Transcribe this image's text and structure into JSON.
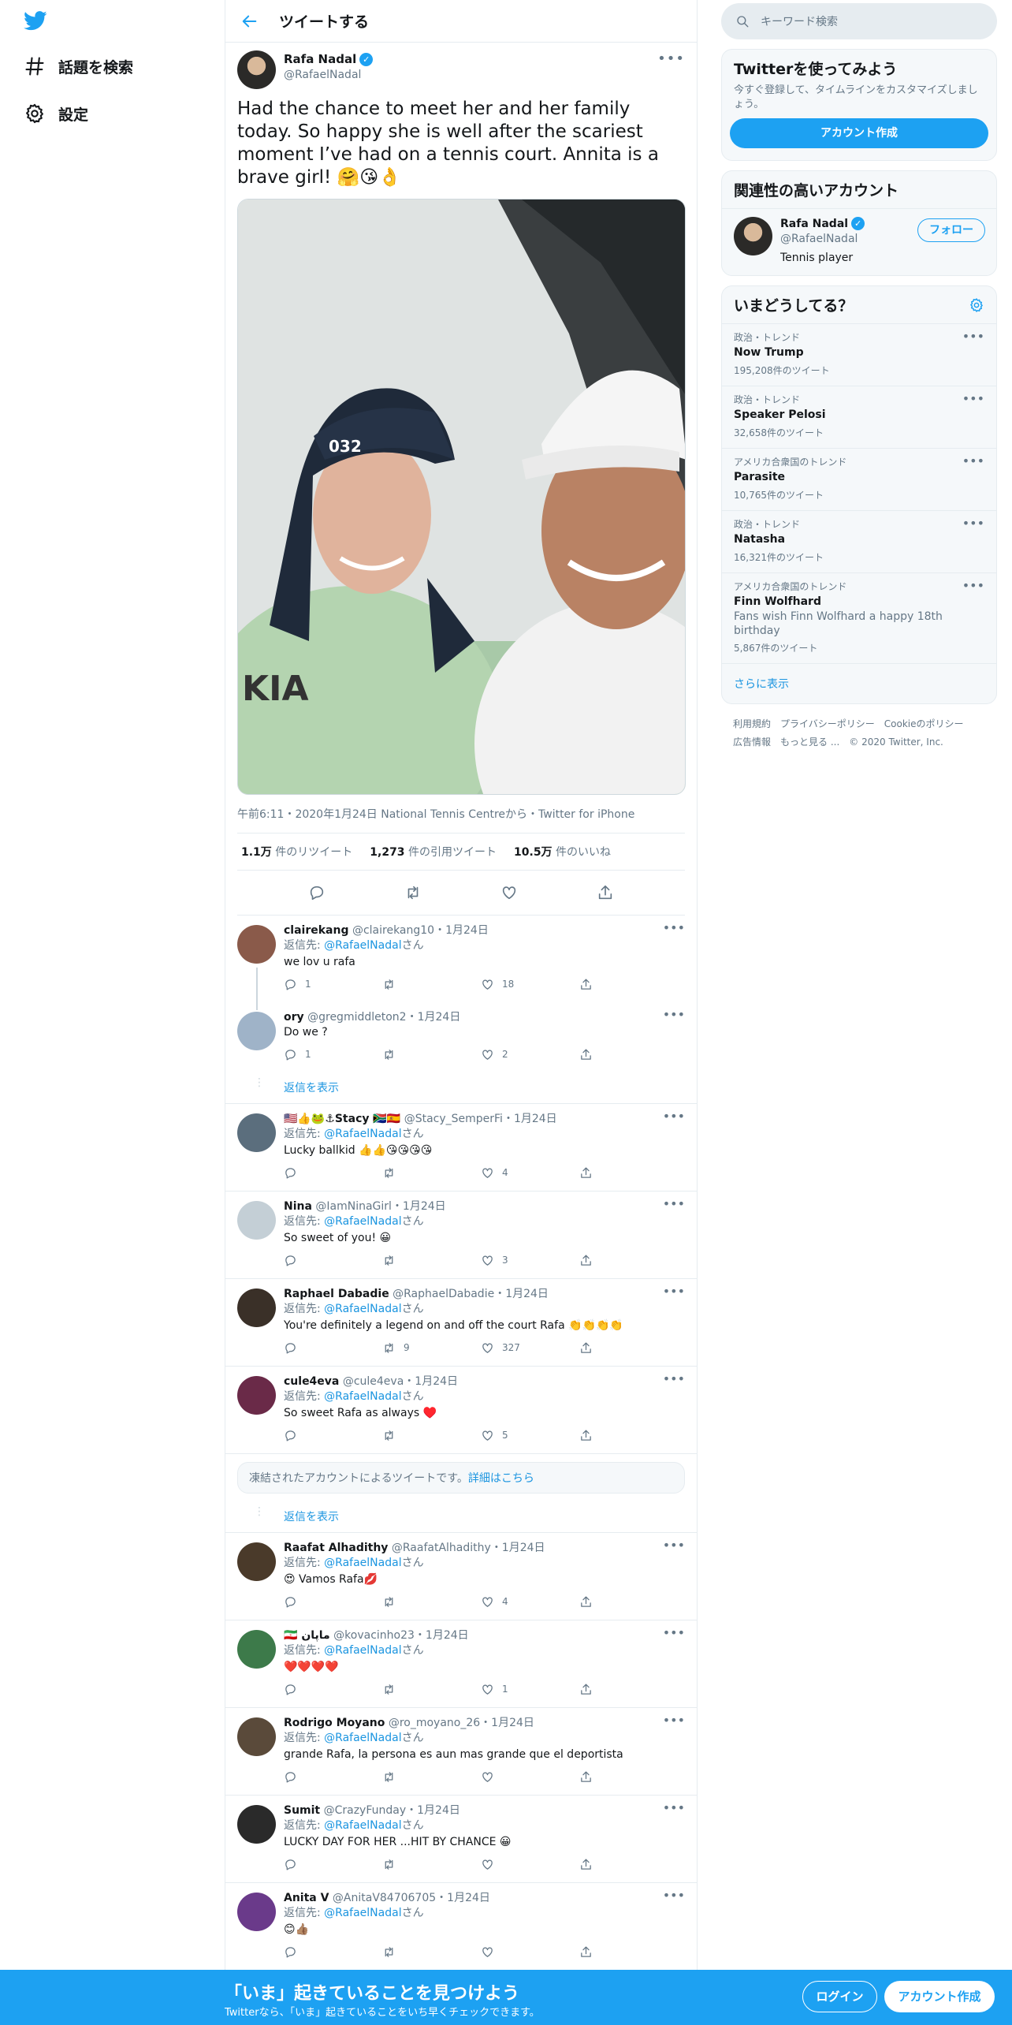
{
  "nav": {
    "items": [
      {
        "label": "話題を検索",
        "icon": "hashtag-icon"
      },
      {
        "label": "設定",
        "icon": "gear-icon"
      }
    ]
  },
  "header": {
    "title": "ツイートする"
  },
  "tweet": {
    "name": "Rafa Nadal",
    "handle": "@RafaelNadal",
    "text": "Had the chance to meet her and her family today. So happy she is well after the scariest moment I’ve had on a tennis court. Annita is a brave girl! 🤗😘👌",
    "meta": "午前6:11・2020年1月24日 National Tennis Centreから・Twitter for iPhone",
    "stats": {
      "retweets_num": "1.1万",
      "retweets_label": "件のリツイート",
      "quotes_num": "1,273",
      "quotes_label": "件の引用ツイート",
      "likes_num": "10.5万",
      "likes_label": "件のいいね"
    }
  },
  "replies": [
    {
      "name": "clairekang",
      "handle": "@clairekang10",
      "date": "・1月24日",
      "reply_prefix": "返信先: ",
      "reply_to": "@RafaelNadal",
      "reply_suffix": "さん",
      "text": "we lov u rafa",
      "replies": "1",
      "retweets": "",
      "likes": "18",
      "avatar": "#8a5a4a"
    },
    {
      "name": "ory",
      "handle": "@gregmiddleton2",
      "date": "・1月24日",
      "reply_prefix": "",
      "reply_to": "",
      "reply_suffix": "",
      "text": "Do we ?",
      "replies": "1",
      "retweets": "",
      "likes": "2",
      "avatar": "#9fb3c8"
    },
    {
      "name": "🇺🇸👍🐸⚓Stacy 🇿🇦🇪🇸",
      "handle": "@Stacy_SemperFi",
      "date": "・1月24日",
      "reply_prefix": "返信先: ",
      "reply_to": "@RafaelNadal",
      "reply_suffix": "さん",
      "text": "Lucky ballkid 👍👍😘😘😘😘",
      "replies": "",
      "retweets": "",
      "likes": "4",
      "avatar": "#5b6e7d"
    },
    {
      "name": "Nina",
      "handle": "@IamNinaGirl",
      "date": "・1月24日",
      "reply_prefix": "返信先: ",
      "reply_to": "@RafaelNadal",
      "reply_suffix": "さん",
      "text": "So sweet of you! 😀",
      "replies": "",
      "retweets": "",
      "likes": "3",
      "avatar": "#c4cfd6"
    },
    {
      "name": "Raphael Dabadie",
      "handle": "@RaphaelDabadie",
      "date": "・1月24日",
      "reply_prefix": "返信先: ",
      "reply_to": "@RafaelNadal",
      "reply_suffix": "さん",
      "text": "You're definitely a legend on and off the court Rafa 👏👏👏👏",
      "replies": "",
      "retweets": "9",
      "likes": "327",
      "avatar": "#3a3028"
    },
    {
      "name": "cule4eva",
      "handle": "@cule4eva",
      "date": "・1月24日",
      "reply_prefix": "返信先: ",
      "reply_to": "@RafaelNadal",
      "reply_suffix": "さん",
      "text": "So sweet Rafa as always ♥️",
      "replies": "",
      "retweets": "",
      "likes": "5",
      "avatar": "#6a2a48"
    }
  ],
  "show_replies_label": "返信を表示",
  "blocked": {
    "text": "凍結されたアカウントによるツイートです。",
    "link": "詳細はこちら"
  },
  "replies2": [
    {
      "name": "Raafat Alhadithy",
      "handle": "@RaafatAlhadithy",
      "date": "・1月24日",
      "reply_prefix": "返信先: ",
      "reply_to": "@RafaelNadal",
      "reply_suffix": "さん",
      "text": "😍 Vamos Rafa💋",
      "replies": "",
      "retweets": "",
      "likes": "4",
      "avatar": "#4a3a2a"
    },
    {
      "name": "🇮🇷 ماپان",
      "handle": "@kovacinho23",
      "date": "・1月24日",
      "reply_prefix": "返信先: ",
      "reply_to": "@RafaelNadal",
      "reply_suffix": "さん",
      "text": "❤️❤️❤️❤️",
      "replies": "",
      "retweets": "",
      "likes": "1",
      "avatar": "#3d7a4a"
    },
    {
      "name": "Rodrigo Moyano",
      "handle": "@ro_moyano_26",
      "date": "・1月24日",
      "reply_prefix": "返信先: ",
      "reply_to": "@RafaelNadal",
      "reply_suffix": "さん",
      "text": "grande Rafa, la persona es aun mas grande que el deportista",
      "replies": "",
      "retweets": "",
      "likes": "",
      "avatar": "#5a4a3a"
    },
    {
      "name": "Sumit",
      "handle": "@CrazyFunday",
      "date": "・1月24日",
      "reply_prefix": "返信先: ",
      "reply_to": "@RafaelNadal",
      "reply_suffix": "さん",
      "text": "LUCKY DAY FOR HER     ...HIT BY CHANCE 😀",
      "replies": "",
      "retweets": "",
      "likes": "",
      "avatar": "#2a2a2a"
    },
    {
      "name": "Anita V",
      "handle": "@AnitaV84706705",
      "date": "・1月24日",
      "reply_prefix": "返信先: ",
      "reply_to": "@RafaelNadal",
      "reply_suffix": "さん",
      "text": "😊👍🏽",
      "replies": "",
      "retweets": "",
      "likes": "",
      "avatar": "#6a3a8a"
    }
  ],
  "right": {
    "search_placeholder": "キーワード検索",
    "signup": {
      "title": "Twitterを使ってみよう",
      "sub": "今すぐ登録して、タイムラインをカスタマイズしましょう。",
      "button": "アカウント作成"
    },
    "related": {
      "title": "関連性の高いアカウント",
      "name": "Rafa Nadal",
      "handle": "@RafaelNadal",
      "bio": "Tennis player",
      "follow": "フォロー"
    },
    "trends": {
      "title": "いまどうしてる？",
      "items": [
        {
          "ctx": "政治・トレンド",
          "name": "Now Trump",
          "desc": "",
          "count": "195,208件のツイート"
        },
        {
          "ctx": "政治・トレンド",
          "name": "Speaker Pelosi",
          "desc": "",
          "count": "32,658件のツイート"
        },
        {
          "ctx": "アメリカ合衆国のトレンド",
          "name": "Parasite",
          "desc": "",
          "count": "10,765件のツイート"
        },
        {
          "ctx": "政治・トレンド",
          "name": "Natasha",
          "desc": "",
          "count": "16,321件のツイート"
        },
        {
          "ctx": "アメリカ合衆国のトレンド",
          "name": "Finn Wolfhard",
          "desc": "Fans wish Finn Wolfhard a happy 18th birthday",
          "count": "5,867件のツイート"
        }
      ],
      "show_more": "さらに表示"
    },
    "footer": [
      "利用規約",
      "プライバシーポリシー",
      "Cookieのポリシー",
      "広告情報",
      "もっと見る ...",
      "© 2020 Twitter, Inc."
    ]
  },
  "bottom": {
    "title": "「いま」起きていることを見つけよう",
    "sub": "Twitterなら、「いま」起きていることをいち早くチェックできます。",
    "login": "ログイン",
    "signup": "アカウント作成"
  },
  "colors": {
    "accent": "#1da1f2",
    "link": "#1b95e0",
    "muted": "#657786",
    "border": "#e6ecf0"
  }
}
